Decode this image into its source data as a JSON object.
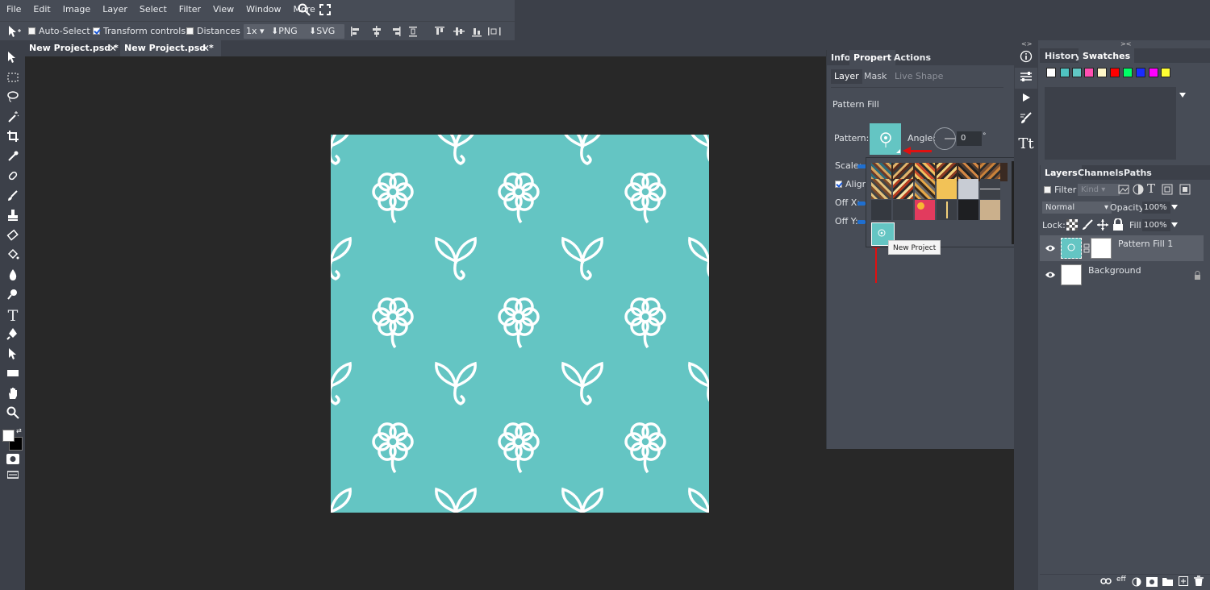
{
  "menu": [
    "File",
    "Edit",
    "Image",
    "Layer",
    "Select",
    "Filter",
    "View",
    "Window",
    "More"
  ],
  "options": {
    "auto_select": "Auto-Select",
    "transform_controls": "Transform controls",
    "distances": "Distances",
    "scale": "1x",
    "png": "PNG",
    "svg": "SVG"
  },
  "tabs": [
    {
      "label": "New Project.psd *"
    },
    {
      "label": "New Project.psd *"
    }
  ],
  "properties": {
    "tabs": [
      "Info",
      "Propert",
      "Actions"
    ],
    "subtabs": [
      "Layer",
      "Mask",
      "Live Shape"
    ],
    "title": "Pattern Fill",
    "pattern_label": "Pattern:",
    "angle_label": "Angle:",
    "angle_value": "0",
    "angle_unit": "°",
    "scale_label": "Scale:",
    "align_label": "Align",
    "offx_label": "Off X:",
    "offy_label": "Off Y:",
    "tooltip": "New Project"
  },
  "history": {
    "tabs": [
      "History",
      "Swatches"
    ],
    "swatches": [
      "#ffffff",
      "#4fc3c1",
      "#61c7c4",
      "#ff4fb2",
      "#fff7c8",
      "#ff0000",
      "#00ff66",
      "#1a2cff",
      "#ff00ff",
      "#ffff33"
    ]
  },
  "layers": {
    "tabs": [
      "Layers",
      "Channels",
      "Paths"
    ],
    "filter_label": "Filter",
    "kind_label": "Kind",
    "blend_mode": "Normal",
    "opacity_label": "Opacity:",
    "opacity_value": "100%",
    "lock_label": "Lock:",
    "fill_label": "Fill:",
    "fill_value": "100%",
    "items": [
      {
        "name": "Pattern Fill 1"
      },
      {
        "name": "Background"
      }
    ],
    "footer": {
      "link": "eff"
    }
  },
  "colors": {
    "accent": "#64c5c3",
    "workspace": "#282828",
    "panel": "#474c56"
  }
}
